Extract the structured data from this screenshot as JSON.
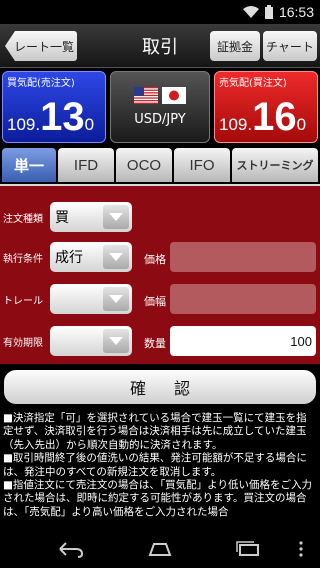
{
  "status_bar": {
    "time": "16:53"
  },
  "header": {
    "back_label": "レート一覧",
    "title": "取引",
    "btn_margin": "証拠金",
    "btn_chart": "チャート"
  },
  "quotes": {
    "buy": {
      "label": "買気配(売注文)",
      "price_prefix": "109.",
      "price_big": "13",
      "price_suffix": "0",
      "color": "#1f3bd6"
    },
    "sell": {
      "label": "売気配(買注文)",
      "price_prefix": "109.",
      "price_big": "16",
      "price_suffix": "0",
      "color": "#d41616"
    },
    "pair": "USD/JPY"
  },
  "tabs": [
    "単一",
    "IFD",
    "OCO",
    "IFO",
    "ストリーミング"
  ],
  "active_tab": "単一",
  "form": {
    "order_type_label": "注文種類",
    "order_type_value": "買",
    "condition_label": "執行条件",
    "condition_value": "成行",
    "price_label": "価格",
    "trail_label": "トレール",
    "trail_value": "",
    "range_label": "価幅",
    "expiry_label": "有効期限",
    "expiry_value": "",
    "quantity_label": "数量",
    "quantity_value": "100"
  },
  "confirm_label": "確認",
  "notes": [
    "■決済指定「可」を選択されている場合で建玉一覧にて建玉を指定せず、決済取引を行う場合は決済相手は先に成立していた建玉（先入先出）から順次自動的に決済されます。",
    "■取引時間終了後の値洗いの結果、発注可能額が不足する場合には、発注中のすべての新規注文を取消します。",
    "■指値注文にて売注文の場合は、「買気配」より低い価格をご入力された場合は、即時に約定する可能性があります。買注文の場合は、「売気配」より高い価格をご入力された場合"
  ],
  "colors": {
    "form_bg": "#8c0b12",
    "tab_active": "#4a6fc4",
    "disabled_field": "#b25a5e"
  }
}
